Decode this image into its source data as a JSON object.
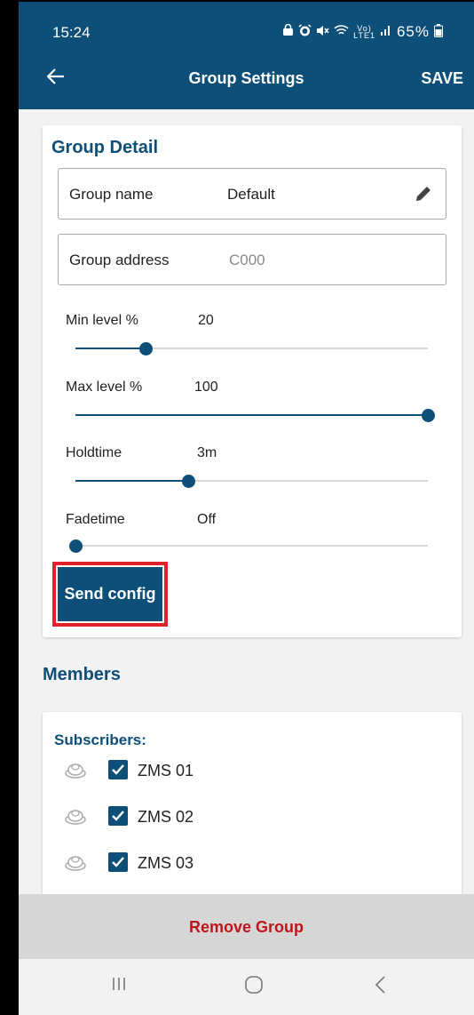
{
  "status_bar": {
    "time": "15:24",
    "battery": "65%"
  },
  "app_bar": {
    "title": "Group Settings",
    "save_label": "SAVE"
  },
  "group_detail": {
    "heading": "Group Detail",
    "name_label": "Group name",
    "name_value": "Default",
    "address_label": "Group address",
    "address_value": "C000",
    "sliders": [
      {
        "label": "Min level %",
        "value": "20",
        "position": 0.2
      },
      {
        "label": "Max level %",
        "value": "100",
        "position": 1.0
      },
      {
        "label": "Holdtime",
        "value": "3m",
        "position": 0.32
      },
      {
        "label": "Fadetime",
        "value": "Off",
        "position": 0.0
      }
    ],
    "send_label": "Send config"
  },
  "members": {
    "heading": "Members",
    "subscribers_label": "Subscribers:",
    "items": [
      {
        "name": "ZMS 01",
        "checked": true
      },
      {
        "name": "ZMS 02",
        "checked": true
      },
      {
        "name": "ZMS 03",
        "checked": true
      }
    ]
  },
  "remove_label": "Remove Group",
  "colors": {
    "primary": "#0d4f78",
    "danger": "#c0141c",
    "highlight": "#e0202a"
  }
}
